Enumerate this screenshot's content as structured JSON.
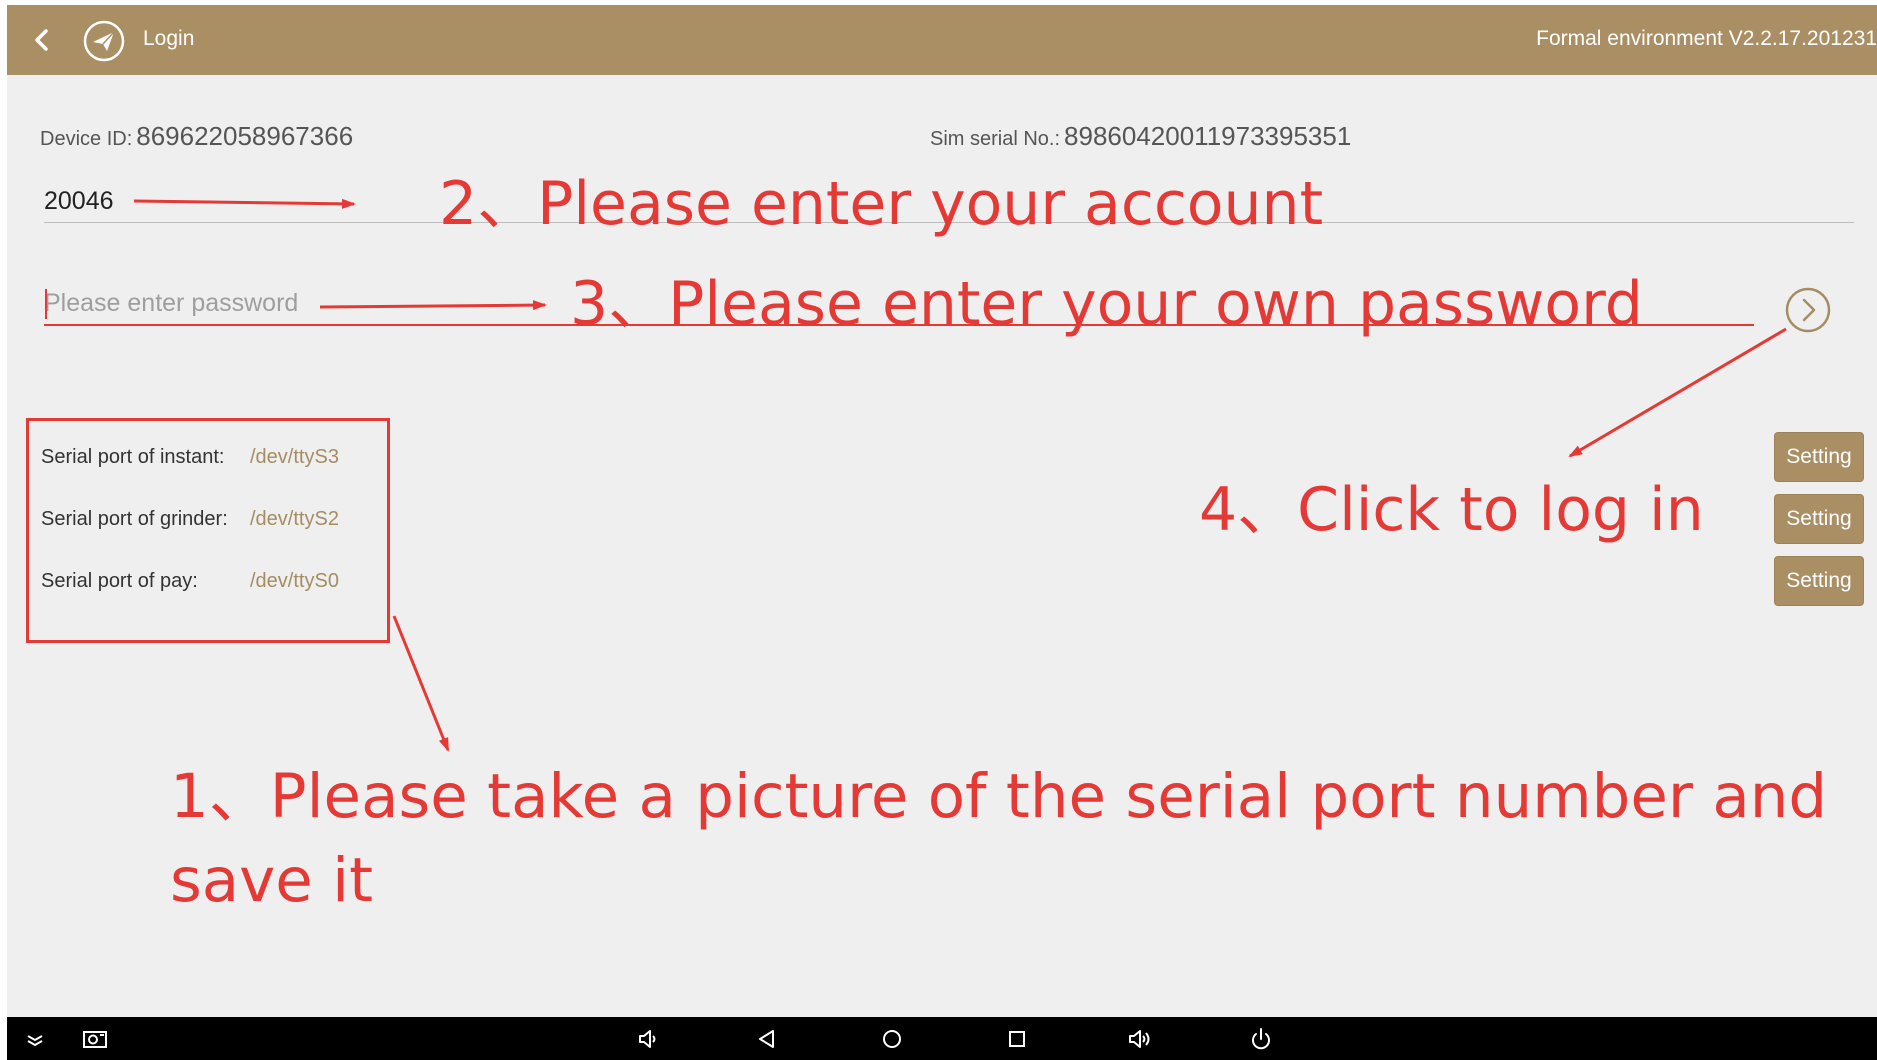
{
  "titlebar": {
    "title": "Login",
    "version": "Formal environment V2.2.17.201231"
  },
  "device": {
    "device_id_label": "Device ID:",
    "device_id_value": "869622058967366",
    "sim_label": "Sim serial No.:",
    "sim_value": "89860420011973395351"
  },
  "login_form": {
    "account_value": "20046",
    "password_placeholder": "Please enter password"
  },
  "serial_ports": [
    {
      "label": "Serial port of instant:",
      "value": "/dev/ttyS3",
      "button": "Setting"
    },
    {
      "label": "Serial port of grinder:",
      "value": "/dev/ttyS2",
      "button": "Setting"
    },
    {
      "label": "Serial port of pay:",
      "value": "/dev/ttyS0",
      "button": "Setting"
    }
  ],
  "annotations": {
    "step1": "1、Please take a picture of the serial port number and save it",
    "step2": "2、Please enter your account",
    "step3": "3、Please enter your own password",
    "step4": "4、Click to log in"
  },
  "colors": {
    "titlebar": "#ab8f64",
    "annotation": "#e53935",
    "port_value": "#a58d62",
    "background": "#efefef"
  },
  "icons": {
    "back": "chevron-left-icon",
    "logo": "paper-plane-icon",
    "login": "chevron-right-circle-icon",
    "nav": [
      "expand-icon",
      "screenshot-icon",
      "volume-down-icon",
      "back-triangle-icon",
      "home-circle-icon",
      "recents-square-icon",
      "volume-up-icon",
      "power-icon"
    ]
  }
}
